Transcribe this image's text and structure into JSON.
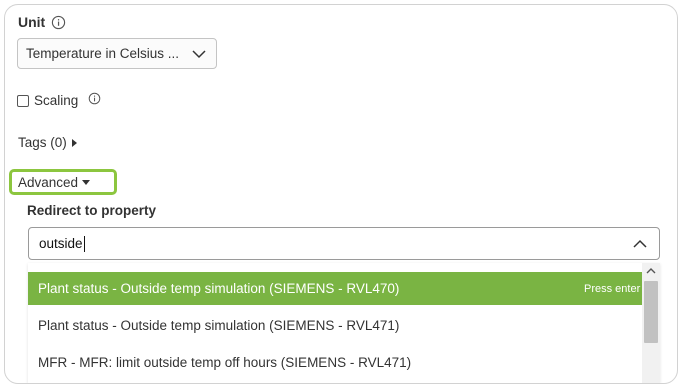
{
  "unit": {
    "label": "Unit",
    "info_icon": "info-circle-icon",
    "selected_value": "Temperature in Celsius ...",
    "chevron_icon": "chevron-down-icon"
  },
  "scaling": {
    "label": "Scaling",
    "checked": false,
    "info_icon": "info-circle-icon"
  },
  "tags": {
    "label": "Tags (0)",
    "caret_icon": "caret-right-icon"
  },
  "advanced": {
    "label": "Advanced",
    "caret_icon": "caret-down-icon",
    "highlight_color": "#8cc63f"
  },
  "redirect": {
    "label": "Redirect to property",
    "search_value": "outside",
    "chevron_icon": "chevron-up-icon",
    "options": [
      {
        "label": "Plant status - Outside temp simulation (SIEMENS - RVL470)",
        "highlighted": true,
        "hint": "Press enter"
      },
      {
        "label": "Plant status - Outside temp simulation (SIEMENS - RVL471)",
        "highlighted": false
      },
      {
        "label": "MFR - MFR: limit outside temp off hours (SIEMENS - RVL471)",
        "highlighted": false
      }
    ],
    "highlight_color": "#7ab443"
  }
}
